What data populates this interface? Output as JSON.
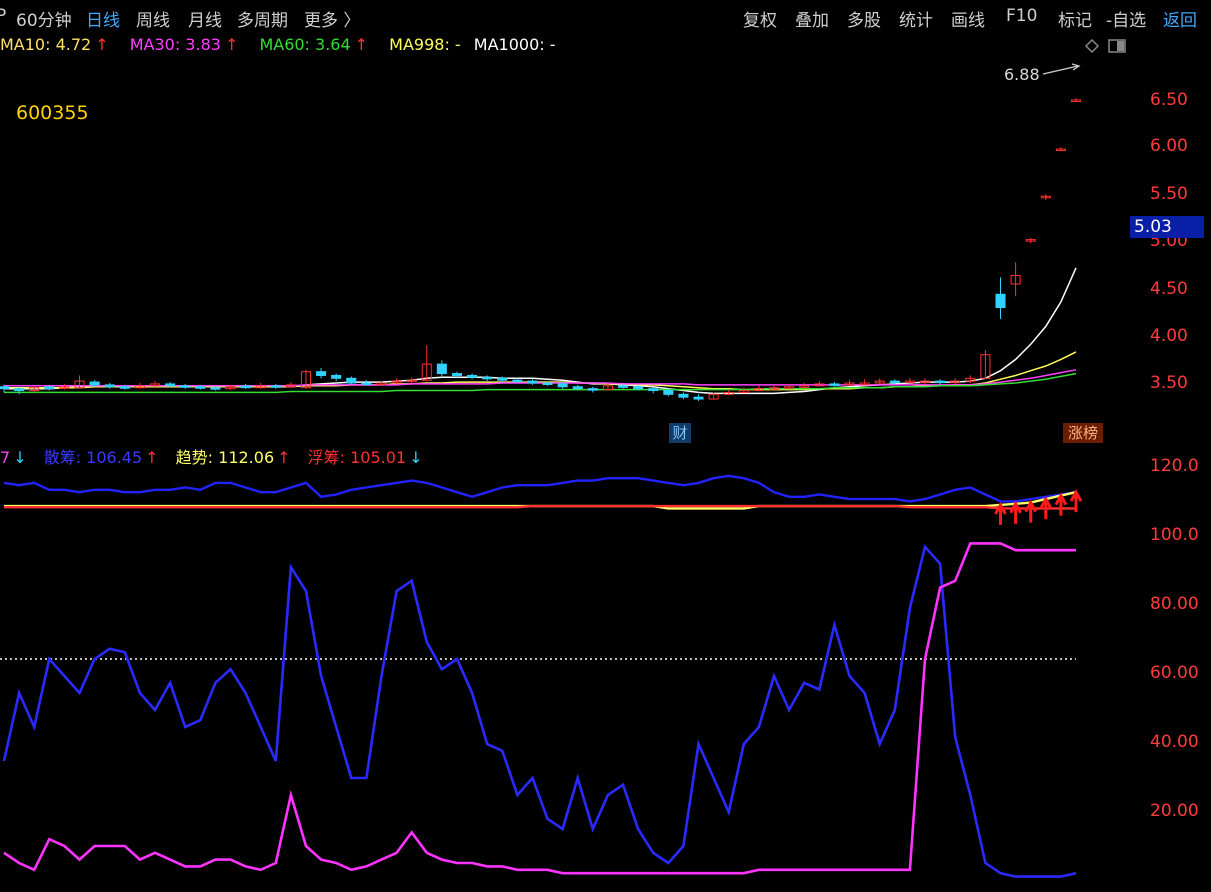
{
  "topbar": {
    "left_marker": "P",
    "items": [
      "60分钟",
      "日线",
      "周线",
      "月线",
      "多周期",
      "更多 〉"
    ],
    "active_index": 1,
    "right_items": [
      "复权",
      "叠加",
      "多股",
      "统计",
      "画线",
      "F10",
      "标记",
      "-自选"
    ],
    "back_label": "返回"
  },
  "ma_legend": [
    {
      "label": "MA10: 4.72",
      "arrow": "↑",
      "color": "#ffe066"
    },
    {
      "label": "MA30: 3.83",
      "arrow": "↑",
      "color": "#ff40ff"
    },
    {
      "label": "MA60: 3.64",
      "arrow": "↑",
      "color": "#33dd33"
    },
    {
      "label": "MA998: -",
      "arrow": "",
      "color": "#ffff55"
    },
    {
      "label": "MA1000: -",
      "arrow": "",
      "color": "#ffffff"
    }
  ],
  "stock_code": "600355",
  "high_price_label": "6.88",
  "current_price_tag": "5.03",
  "markers": {
    "cai": "财",
    "zhangbang": "涨榜"
  },
  "indicator_legend": [
    {
      "label": "7",
      "arrow": "↓",
      "color": "#ff40ff",
      "arrow_color": "#2fd3ff"
    },
    {
      "label": "散筹: 106.45",
      "arrow": "↑",
      "color": "#3a3aff",
      "arrow_color": "#ff3030"
    },
    {
      "label": "趋势: 112.06",
      "arrow": "↑",
      "color": "#ffff66",
      "arrow_color": "#ff3030"
    },
    {
      "label": "浮筹: 105.01",
      "arrow": "↓",
      "color": "#ff3030",
      "arrow_color": "#2fd3ff"
    }
  ],
  "colors": {
    "up": "#ff3030",
    "down": "#2fd3ff",
    "axis": "#ff3b3b"
  },
  "chart_data": [
    {
      "type": "candlestick",
      "title": "",
      "y_ticks": [
        "6.50",
        "6.00",
        "5.50",
        "5.00",
        "4.50",
        "4.00",
        "3.50"
      ],
      "ylim": [
        3.2,
        6.9
      ],
      "x_count": 72,
      "close": [
        3.44,
        3.42,
        3.45,
        3.44,
        3.46,
        3.52,
        3.48,
        3.46,
        3.45,
        3.47,
        3.49,
        3.47,
        3.46,
        3.45,
        3.44,
        3.46,
        3.45,
        3.47,
        3.46,
        3.48,
        3.62,
        3.58,
        3.55,
        3.5,
        3.49,
        3.5,
        3.52,
        3.53,
        3.7,
        3.6,
        3.58,
        3.56,
        3.55,
        3.53,
        3.52,
        3.5,
        3.49,
        3.46,
        3.44,
        3.43,
        3.47,
        3.46,
        3.44,
        3.42,
        3.38,
        3.35,
        3.33,
        3.38,
        3.4,
        3.42,
        3.44,
        3.45,
        3.46,
        3.47,
        3.49,
        3.48,
        3.5,
        3.5,
        3.52,
        3.51,
        3.52,
        3.52,
        3.51,
        3.52,
        3.55,
        3.8,
        4.3,
        4.64,
        5.02,
        5.48,
        5.98,
        6.5
      ],
      "open": [
        3.46,
        3.44,
        3.42,
        3.46,
        3.45,
        3.45,
        3.51,
        3.48,
        3.46,
        3.45,
        3.47,
        3.49,
        3.47,
        3.46,
        3.45,
        3.44,
        3.47,
        3.45,
        3.47,
        3.46,
        3.45,
        3.62,
        3.58,
        3.55,
        3.5,
        3.49,
        3.5,
        3.52,
        3.53,
        3.7,
        3.6,
        3.58,
        3.56,
        3.55,
        3.53,
        3.52,
        3.5,
        3.49,
        3.46,
        3.44,
        3.43,
        3.47,
        3.46,
        3.44,
        3.42,
        3.38,
        3.35,
        3.33,
        3.38,
        3.4,
        3.42,
        3.44,
        3.45,
        3.46,
        3.47,
        3.49,
        3.48,
        3.5,
        3.5,
        3.52,
        3.51,
        3.52,
        3.52,
        3.51,
        3.52,
        3.55,
        4.44,
        4.55,
        5.02,
        5.48,
        5.98,
        6.5
      ],
      "high": [
        3.48,
        3.46,
        3.47,
        3.48,
        3.49,
        3.58,
        3.53,
        3.5,
        3.48,
        3.5,
        3.52,
        3.51,
        3.49,
        3.48,
        3.47,
        3.48,
        3.49,
        3.5,
        3.49,
        3.51,
        3.64,
        3.66,
        3.6,
        3.57,
        3.53,
        3.52,
        3.55,
        3.56,
        3.9,
        3.74,
        3.62,
        3.6,
        3.58,
        3.57,
        3.56,
        3.54,
        3.52,
        3.51,
        3.48,
        3.46,
        3.5,
        3.49,
        3.48,
        3.45,
        3.44,
        3.4,
        3.38,
        3.4,
        3.43,
        3.45,
        3.47,
        3.48,
        3.49,
        3.5,
        3.52,
        3.51,
        3.53,
        3.54,
        3.55,
        3.54,
        3.55,
        3.55,
        3.54,
        3.55,
        3.58,
        3.85,
        4.62,
        4.78,
        5.04,
        5.5,
        6.0,
        6.52
      ],
      "low": [
        3.4,
        3.38,
        3.4,
        3.42,
        3.43,
        3.44,
        3.46,
        3.44,
        3.43,
        3.44,
        3.46,
        3.45,
        3.44,
        3.43,
        3.42,
        3.43,
        3.44,
        3.44,
        3.44,
        3.45,
        3.44,
        3.55,
        3.52,
        3.48,
        3.47,
        3.47,
        3.49,
        3.5,
        3.52,
        3.56,
        3.55,
        3.54,
        3.52,
        3.51,
        3.5,
        3.48,
        3.47,
        3.44,
        3.42,
        3.4,
        3.42,
        3.44,
        3.42,
        3.39,
        3.36,
        3.33,
        3.31,
        3.33,
        3.37,
        3.4,
        3.41,
        3.43,
        3.44,
        3.45,
        3.46,
        3.46,
        3.47,
        3.48,
        3.49,
        3.49,
        3.5,
        3.49,
        3.48,
        3.49,
        3.5,
        3.54,
        4.18,
        4.42,
        4.98,
        5.44,
        5.96,
        6.48
      ],
      "series": [
        {
          "name": "MA10",
          "color": "#ffffff",
          "values": [
            3.44,
            3.44,
            3.44,
            3.44,
            3.45,
            3.46,
            3.46,
            3.46,
            3.46,
            3.46,
            3.46,
            3.47,
            3.47,
            3.47,
            3.46,
            3.46,
            3.46,
            3.46,
            3.46,
            3.46,
            3.48,
            3.49,
            3.5,
            3.51,
            3.51,
            3.51,
            3.52,
            3.53,
            3.55,
            3.56,
            3.56,
            3.56,
            3.56,
            3.55,
            3.55,
            3.55,
            3.54,
            3.53,
            3.51,
            3.49,
            3.49,
            3.48,
            3.47,
            3.46,
            3.44,
            3.42,
            3.4,
            3.39,
            3.39,
            3.39,
            3.39,
            3.39,
            3.4,
            3.41,
            3.43,
            3.45,
            3.46,
            3.47,
            3.48,
            3.49,
            3.5,
            3.51,
            3.51,
            3.51,
            3.52,
            3.55,
            3.63,
            3.75,
            3.91,
            4.1,
            4.36,
            4.72
          ]
        },
        {
          "name": "MA30",
          "color": "#ffff55",
          "values": [
            3.45,
            3.45,
            3.45,
            3.45,
            3.45,
            3.45,
            3.46,
            3.46,
            3.46,
            3.46,
            3.46,
            3.46,
            3.46,
            3.46,
            3.46,
            3.46,
            3.46,
            3.46,
            3.46,
            3.46,
            3.47,
            3.47,
            3.47,
            3.48,
            3.48,
            3.48,
            3.49,
            3.49,
            3.5,
            3.5,
            3.51,
            3.51,
            3.51,
            3.51,
            3.51,
            3.51,
            3.51,
            3.51,
            3.5,
            3.5,
            3.49,
            3.49,
            3.48,
            3.48,
            3.47,
            3.46,
            3.45,
            3.44,
            3.44,
            3.43,
            3.43,
            3.43,
            3.43,
            3.43,
            3.44,
            3.44,
            3.44,
            3.45,
            3.45,
            3.46,
            3.46,
            3.47,
            3.47,
            3.48,
            3.48,
            3.5,
            3.54,
            3.58,
            3.63,
            3.68,
            3.75,
            3.83
          ]
        },
        {
          "name": "MA60",
          "color": "#ff40ff",
          "values": [
            3.47,
            3.47,
            3.47,
            3.47,
            3.47,
            3.47,
            3.47,
            3.47,
            3.47,
            3.47,
            3.47,
            3.47,
            3.47,
            3.47,
            3.47,
            3.47,
            3.47,
            3.47,
            3.47,
            3.47,
            3.48,
            3.48,
            3.48,
            3.48,
            3.48,
            3.48,
            3.48,
            3.49,
            3.49,
            3.49,
            3.49,
            3.49,
            3.49,
            3.5,
            3.5,
            3.5,
            3.5,
            3.5,
            3.5,
            3.5,
            3.5,
            3.49,
            3.49,
            3.49,
            3.49,
            3.49,
            3.48,
            3.48,
            3.48,
            3.48,
            3.48,
            3.48,
            3.48,
            3.48,
            3.48,
            3.48,
            3.48,
            3.48,
            3.48,
            3.48,
            3.48,
            3.48,
            3.48,
            3.48,
            3.48,
            3.49,
            3.51,
            3.53,
            3.55,
            3.58,
            3.61,
            3.64
          ]
        },
        {
          "name": "MA998",
          "color": "#33dd33",
          "values": [
            3.4,
            3.4,
            3.4,
            3.4,
            3.4,
            3.4,
            3.4,
            3.4,
            3.4,
            3.4,
            3.4,
            3.4,
            3.4,
            3.4,
            3.4,
            3.4,
            3.4,
            3.4,
            3.4,
            3.41,
            3.41,
            3.41,
            3.41,
            3.41,
            3.41,
            3.41,
            3.42,
            3.42,
            3.42,
            3.42,
            3.42,
            3.42,
            3.43,
            3.43,
            3.43,
            3.43,
            3.43,
            3.43,
            3.43,
            3.43,
            3.43,
            3.43,
            3.43,
            3.43,
            3.43,
            3.43,
            3.43,
            3.43,
            3.43,
            3.43,
            3.44,
            3.44,
            3.44,
            3.44,
            3.44,
            3.45,
            3.45,
            3.45,
            3.45,
            3.46,
            3.46,
            3.46,
            3.47,
            3.47,
            3.47,
            3.48,
            3.49,
            3.5,
            3.52,
            3.54,
            3.57,
            3.6
          ]
        }
      ]
    },
    {
      "type": "line",
      "title": "",
      "y_ticks": [
        "120.0"
      ],
      "ylim": [
        100,
        125
      ],
      "series": [
        {
          "name": "散筹",
          "color": "#2222ff",
          "values": [
            116,
            115,
            116,
            113,
            113,
            112,
            113,
            113,
            112,
            112,
            113,
            113,
            114,
            113,
            116,
            116,
            114,
            112,
            112,
            114,
            116,
            110,
            111,
            113,
            114,
            115,
            116,
            117,
            116,
            114,
            112,
            110,
            112,
            114,
            115,
            115,
            115,
            116,
            117,
            117,
            118,
            118,
            118,
            117,
            116,
            115,
            116,
            118,
            119,
            118,
            116,
            112,
            110,
            110,
            111,
            110,
            109,
            109,
            109,
            109,
            108,
            109,
            111,
            113,
            114,
            111,
            108,
            108,
            109,
            110,
            111,
            112
          ]
        },
        {
          "name": "趋势",
          "color": "#ffff66",
          "values": [
            106,
            106,
            106,
            106,
            106,
            106,
            106,
            106,
            106,
            106,
            106,
            106,
            106,
            106,
            106,
            106,
            106,
            106,
            106,
            106,
            106,
            106,
            106,
            106,
            106,
            106,
            106,
            106,
            106,
            106,
            106,
            106,
            106,
            106,
            106,
            106,
            106,
            106,
            106,
            106,
            106,
            106,
            106,
            106,
            105,
            105,
            105,
            105,
            105,
            105,
            106,
            106,
            106,
            106,
            106,
            106,
            106,
            106,
            106,
            106,
            106,
            106,
            106,
            106,
            106,
            106,
            106.5,
            107,
            107.5,
            109,
            110.5,
            112
          ]
        },
        {
          "name": "浮筹",
          "color": "#ff3030",
          "values": [
            105.5,
            105.5,
            105.5,
            105.5,
            105.5,
            105.5,
            105.5,
            105.5,
            105.5,
            105.5,
            105.5,
            105.5,
            105.5,
            105.5,
            105.5,
            105.5,
            105.5,
            105.5,
            105.5,
            105.5,
            105.5,
            105.5,
            105.5,
            105.5,
            105.5,
            105.5,
            105.5,
            105.5,
            105.5,
            105.5,
            105.5,
            105.5,
            105.5,
            105.5,
            105.5,
            106,
            106,
            106,
            106,
            106,
            106,
            106,
            106,
            106,
            106,
            106,
            106,
            106,
            106,
            106,
            106,
            106,
            106,
            106,
            106,
            106,
            106,
            106,
            106,
            106,
            105.5,
            105.5,
            105.5,
            105.5,
            105.5,
            105.5,
            105,
            105,
            105,
            105,
            105,
            105
          ]
        }
      ]
    },
    {
      "type": "line",
      "title": "",
      "y_ticks": [
        "100.0",
        "80.00",
        "60.00",
        "40.00",
        "20.00"
      ],
      "ylim": [
        0,
        104
      ],
      "reference_line": 65,
      "series": [
        {
          "name": "",
          "color": "#2a2aff",
          "values": [
            35,
            55,
            45,
            65,
            60,
            55,
            65,
            68,
            67,
            55,
            50,
            58,
            45,
            47,
            58,
            62,
            55,
            45,
            35,
            92,
            85,
            60,
            45,
            30,
            30,
            60,
            85,
            88,
            70,
            62,
            65,
            55,
            40,
            38,
            25,
            30,
            18,
            15,
            30,
            15,
            25,
            28,
            15,
            8,
            5,
            10,
            40,
            30,
            20,
            40,
            45,
            60,
            50,
            58,
            56,
            75,
            60,
            55,
            40,
            50,
            80,
            98,
            93,
            42,
            25,
            5,
            2,
            1,
            1,
            1,
            1,
            2
          ]
        },
        {
          "name": "",
          "color": "#ff33ff",
          "values": [
            8,
            5,
            3,
            12,
            10,
            6,
            10,
            10,
            10,
            6,
            8,
            6,
            4,
            4,
            6,
            6,
            4,
            3,
            5,
            25,
            10,
            6,
            5,
            3,
            4,
            6,
            8,
            14,
            8,
            6,
            5,
            5,
            4,
            4,
            3,
            3,
            3,
            2,
            2,
            2,
            2,
            2,
            2,
            2,
            2,
            2,
            2,
            2,
            2,
            2,
            3,
            3,
            3,
            3,
            3,
            3,
            3,
            3,
            3,
            3,
            3,
            65,
            86,
            88,
            99,
            99,
            99,
            97,
            97,
            97,
            97,
            97
          ]
        }
      ]
    }
  ]
}
